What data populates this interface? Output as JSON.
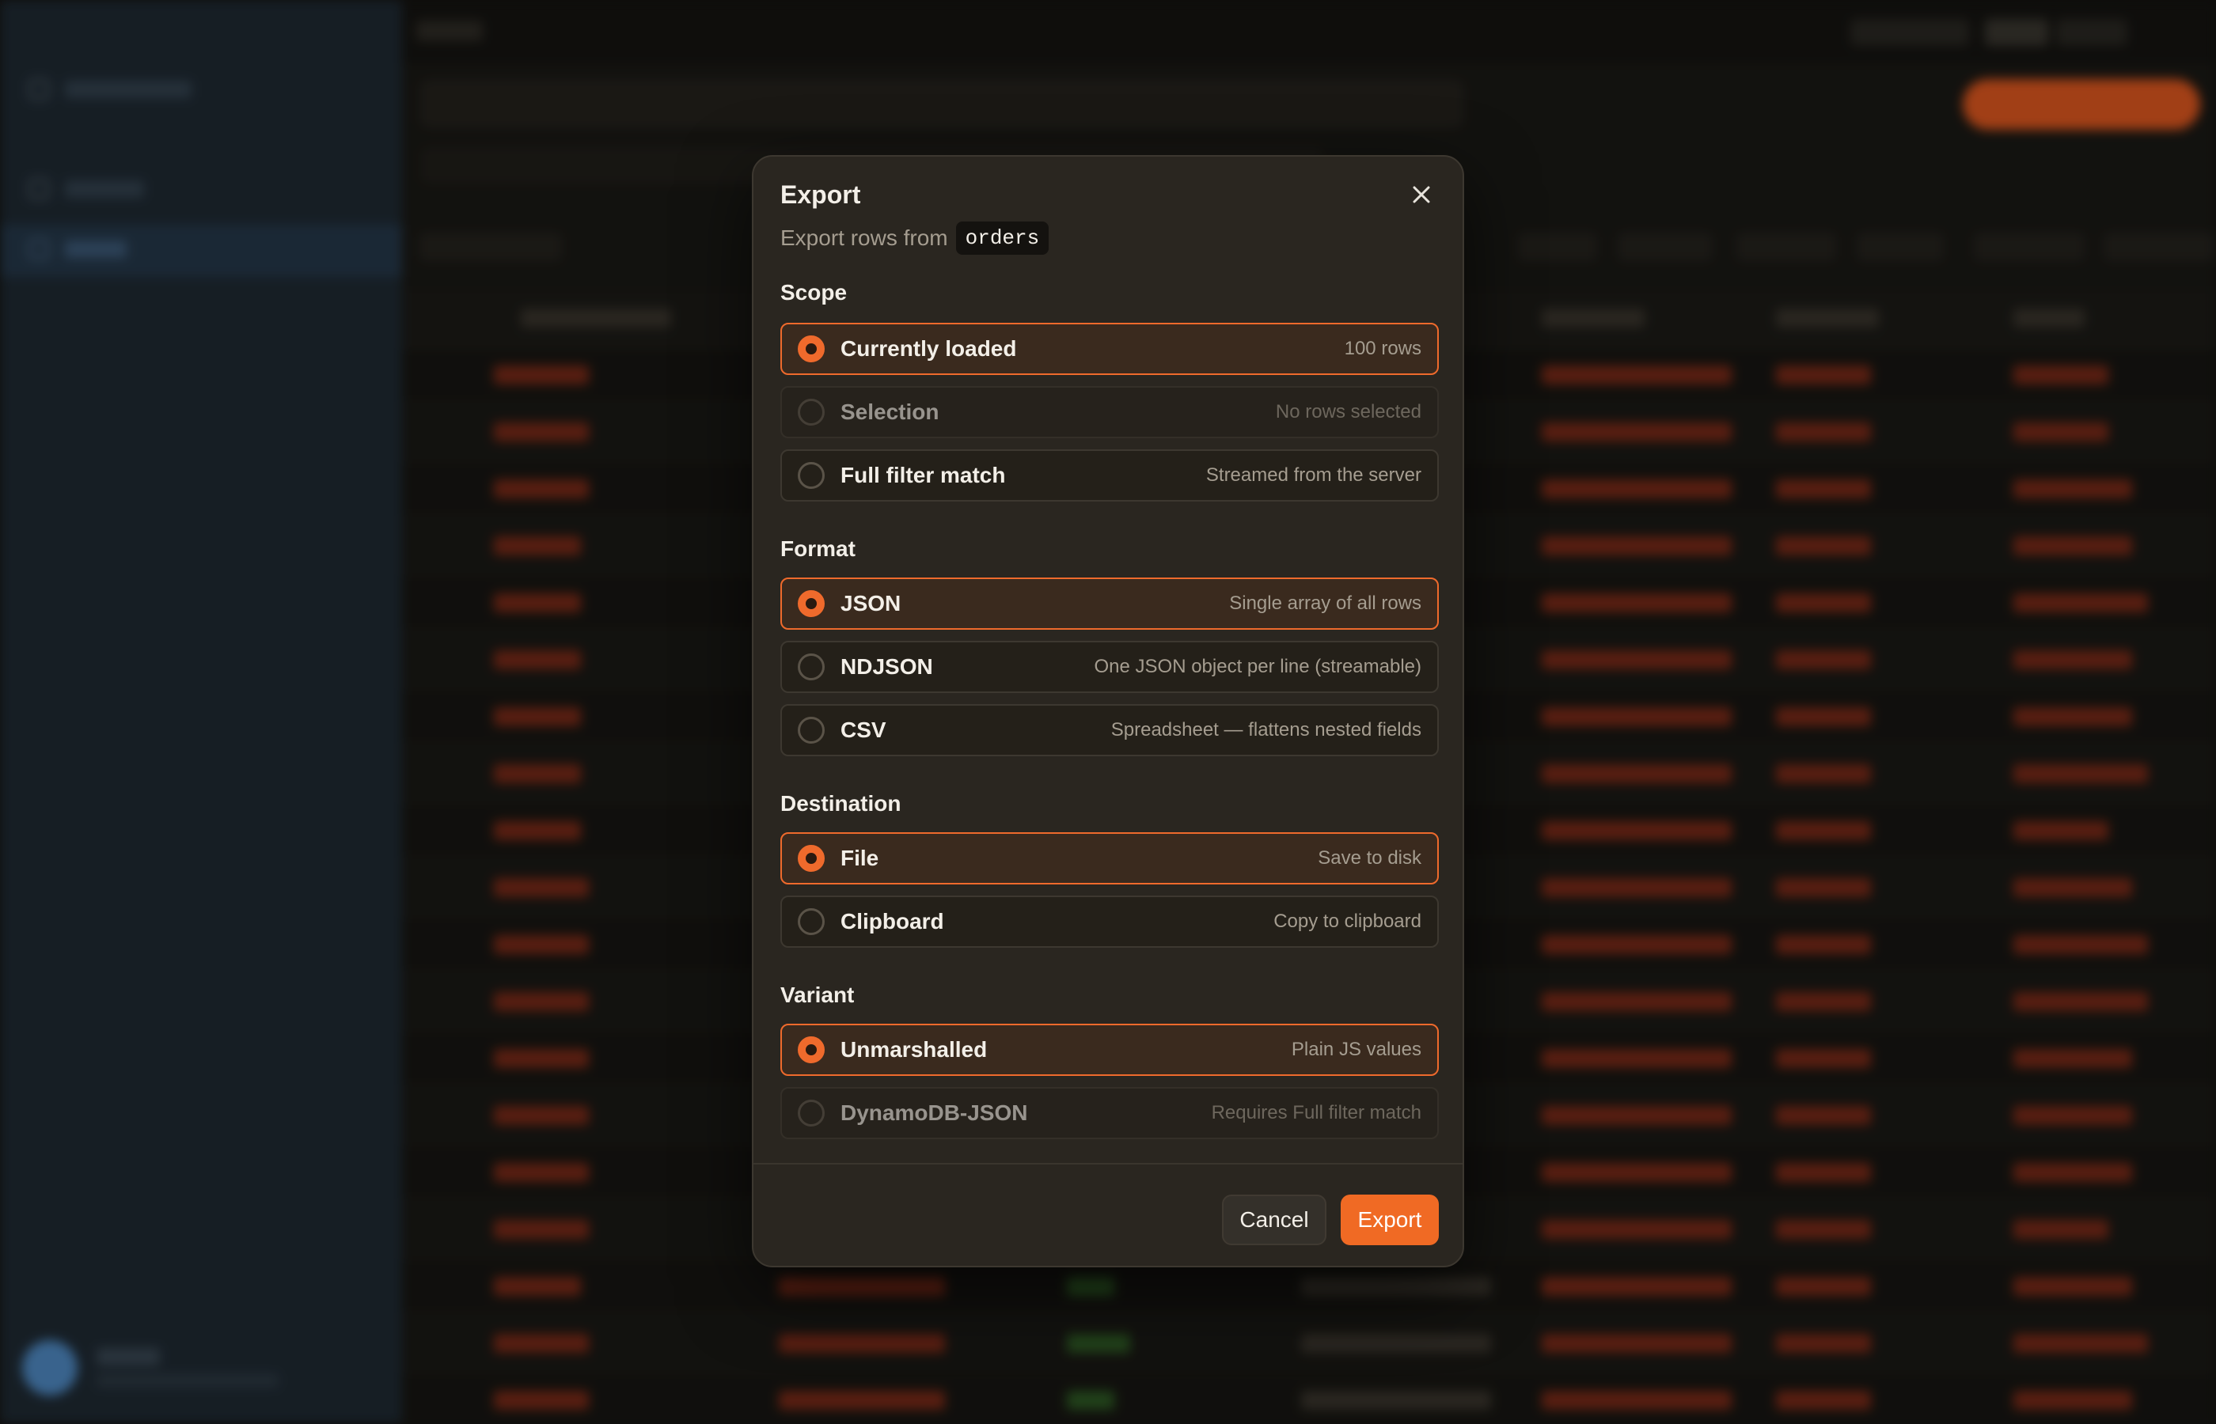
{
  "modal": {
    "title": "Export",
    "subtitle_prefix": "Export rows from",
    "table_name": "orders",
    "sections": {
      "scope": {
        "label": "Scope",
        "options": [
          {
            "label": "Currently loaded",
            "desc": "100 rows",
            "selected": true,
            "disabled": false
          },
          {
            "label": "Selection",
            "desc": "No rows selected",
            "selected": false,
            "disabled": true
          },
          {
            "label": "Full filter match",
            "desc": "Streamed from the server",
            "selected": false,
            "disabled": false
          }
        ]
      },
      "format": {
        "label": "Format",
        "options": [
          {
            "label": "JSON",
            "desc": "Single array of all rows",
            "selected": true,
            "disabled": false
          },
          {
            "label": "NDJSON",
            "desc": "One JSON object per line (streamable)",
            "selected": false,
            "disabled": false
          },
          {
            "label": "CSV",
            "desc": "Spreadsheet — flattens nested fields",
            "selected": false,
            "disabled": false
          }
        ]
      },
      "destination": {
        "label": "Destination",
        "options": [
          {
            "label": "File",
            "desc": "Save to disk",
            "selected": true,
            "disabled": false
          },
          {
            "label": "Clipboard",
            "desc": "Copy to clipboard",
            "selected": false,
            "disabled": false
          }
        ]
      },
      "variant": {
        "label": "Variant",
        "options": [
          {
            "label": "Unmarshalled",
            "desc": "Plain JS values",
            "selected": true,
            "disabled": false
          },
          {
            "label": "DynamoDB-JSON",
            "desc": "Requires Full filter match",
            "selected": false,
            "disabled": true
          }
        ]
      }
    },
    "cancel_label": "Cancel",
    "export_label": "Export"
  },
  "colors": {
    "accent": "#f06a24",
    "modal_bg": "#2a2620",
    "sidebar_bg": "#1f2a33"
  },
  "icons": {
    "close": "close-icon"
  }
}
